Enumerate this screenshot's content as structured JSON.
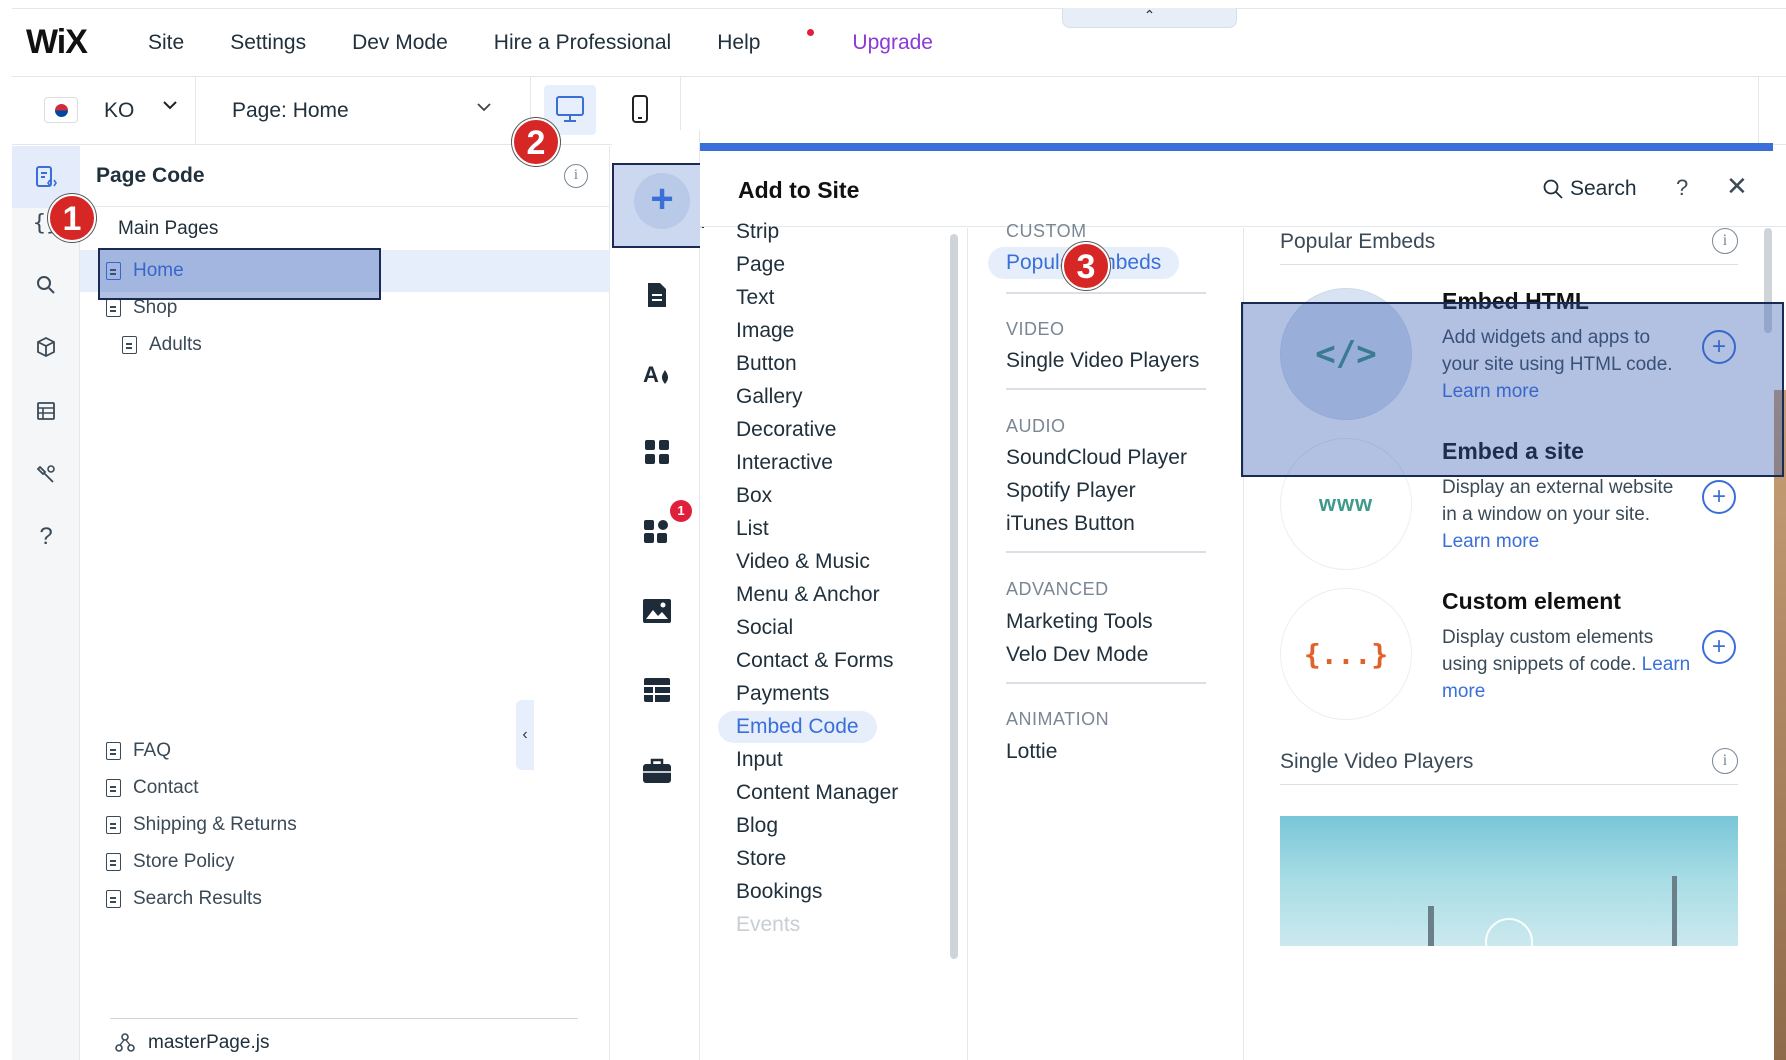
{
  "topbar": {
    "logo": "WiX",
    "nav": [
      "Site",
      "Settings",
      "Dev Mode",
      "Hire a Professional",
      "Help",
      "Upgrade"
    ],
    "collapse_glyph": "⌃"
  },
  "secbar": {
    "language": "KO",
    "page_selector": "Page: Home"
  },
  "code_panel": {
    "title": "Page Code",
    "info_glyph": "i",
    "section_label": "Main Pages",
    "pages_top": [
      "Home",
      "Shop"
    ],
    "sub_page": "Adults",
    "pages_bottom": [
      "FAQ",
      "Contact",
      "Shipping & Returns",
      "Store Policy",
      "Search Results"
    ],
    "master_file": "masterPage.js"
  },
  "add_panel": {
    "title": "Add to Site",
    "search_label": "Search",
    "help_glyph": "?",
    "close_glyph": "✕",
    "notification_count": "1",
    "categories": [
      "Strip",
      "Page",
      "Text",
      "Image",
      "Button",
      "Gallery",
      "Decorative",
      "Interactive",
      "Box",
      "List",
      "Video & Music",
      "Menu & Anchor",
      "Social",
      "Contact & Forms",
      "Payments",
      "Embed Code",
      "Input",
      "Content Manager",
      "Blog",
      "Store",
      "Bookings",
      "Events"
    ],
    "active_category": "Embed Code",
    "subcategories": {
      "custom_head": "CUSTOM",
      "custom_items": [
        "Popular Embeds"
      ],
      "video_head": "VIDEO",
      "video_items": [
        "Single Video Players"
      ],
      "audio_head": "AUDIO",
      "audio_items": [
        "SoundCloud Player",
        "Spotify Player",
        "iTunes Button"
      ],
      "advanced_head": "ADVANCED",
      "advanced_items": [
        "Marketing Tools",
        "Velo Dev Mode"
      ],
      "animation_head": "ANIMATION",
      "animation_items": [
        "Lottie"
      ]
    },
    "content": {
      "popular_title": "Popular Embeds",
      "cards": [
        {
          "icon_text": "</>",
          "title": "Embed HTML",
          "desc": "Add widgets and apps to your site using HTML code.",
          "link": "Learn more"
        },
        {
          "icon_text": "www",
          "title": "Embed a site",
          "desc": "Display an external website in a window on your site.",
          "link": "Learn more"
        },
        {
          "icon_text": "{...}",
          "title": "Custom element",
          "desc": "Display custom elements using snippets of code.",
          "link": "Learn more"
        }
      ],
      "video_title": "Single Video Players"
    }
  },
  "annotations": [
    "1",
    "2",
    "3"
  ],
  "colors": {
    "accent": "#3b6fd8",
    "upgrade": "#8a3ad6",
    "highlight": "#345cb4",
    "badge": "#d62626"
  }
}
